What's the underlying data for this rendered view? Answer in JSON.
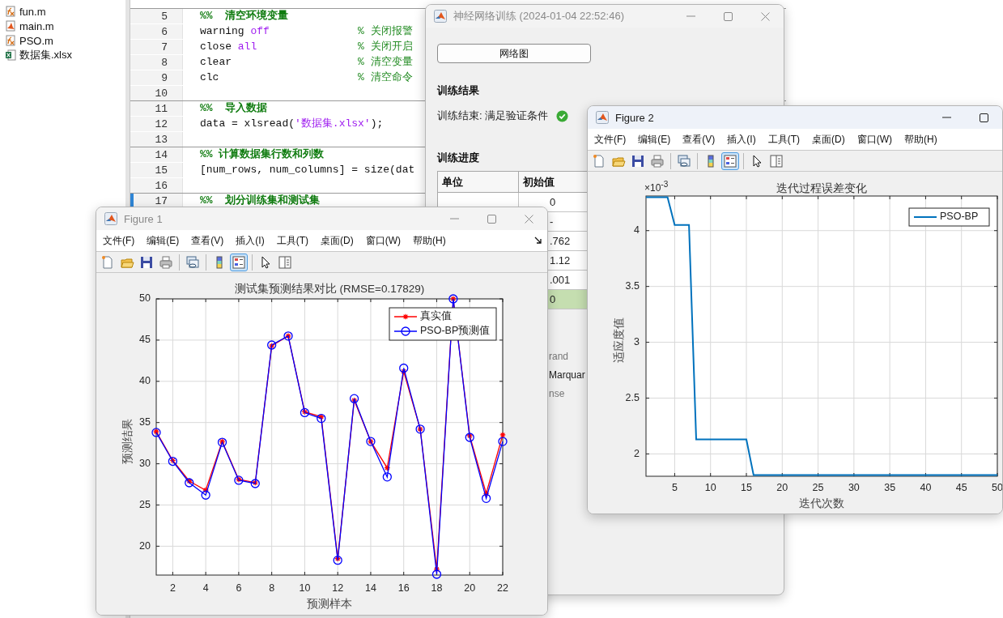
{
  "file_browser": {
    "files": [
      {
        "name": "fun.m",
        "kind": "function"
      },
      {
        "name": "main.m",
        "kind": "script"
      },
      {
        "name": "PSO.m",
        "kind": "function"
      },
      {
        "name": "数据集.xlsx",
        "kind": "spreadsheet"
      }
    ]
  },
  "editor": {
    "lines": [
      {
        "number": "5",
        "current": false,
        "segments": [
          {
            "kind": "section",
            "text": "%%  清空环境变量"
          }
        ]
      },
      {
        "number": "6",
        "current": false,
        "segments": [
          {
            "kind": "plain",
            "text": "warning "
          },
          {
            "kind": "keyword",
            "text": "off"
          },
          {
            "kind": "comment",
            "text": "% 关闭报警"
          }
        ]
      },
      {
        "number": "7",
        "current": false,
        "segments": [
          {
            "kind": "plain",
            "text": "close "
          },
          {
            "kind": "keyword",
            "text": "all"
          },
          {
            "kind": "comment",
            "text": "% 关闭开启"
          }
        ]
      },
      {
        "number": "8",
        "current": false,
        "segments": [
          {
            "kind": "plain",
            "text": "clear"
          },
          {
            "kind": "comment",
            "text": "% 清空变量"
          }
        ]
      },
      {
        "number": "9",
        "current": false,
        "segments": [
          {
            "kind": "plain",
            "text": "clc"
          },
          {
            "kind": "comment",
            "text": "% 清空命令"
          }
        ]
      },
      {
        "number": "10",
        "current": false
      },
      {
        "number": "11",
        "current": false,
        "segments": [
          {
            "kind": "section",
            "text": "%%  导入数据"
          }
        ]
      },
      {
        "number": "12",
        "current": false,
        "segments": [
          {
            "kind": "plain",
            "text": "data = xlsread("
          },
          {
            "kind": "string",
            "text": "'数据集.xlsx'"
          },
          {
            "kind": "plain",
            "text": ");"
          }
        ]
      },
      {
        "number": "13",
        "current": false
      },
      {
        "number": "14",
        "current": false,
        "segments": [
          {
            "kind": "section",
            "text": "%% 计算数据集行数和列数"
          }
        ]
      },
      {
        "number": "15",
        "current": false,
        "segments": [
          {
            "kind": "plain",
            "text": "[num_rows, num_columns] = size(dat"
          }
        ]
      },
      {
        "number": "16",
        "current": false
      },
      {
        "number": "17",
        "current": true,
        "segments": [
          {
            "kind": "section",
            "text": "%%  划分训练集和测试集"
          }
        ]
      }
    ]
  },
  "training_window": {
    "title": "神经网络训练 (2024-01-04 22:52:46)",
    "active": false,
    "button": "网络图",
    "result_heading": "训练结果",
    "result_text": "训练结束: 满足验证条件",
    "result_ok": true,
    "progress_heading": "训练进度",
    "table": {
      "columns": [
        "单位",
        "初始值"
      ],
      "rows": [
        {
          "value": "0",
          "highlighted": false
        },
        {
          "value": "-",
          "highlighted": false
        },
        {
          "value": ".762",
          "highlighted": false
        },
        {
          "value": "1.12",
          "highlighted": false
        },
        {
          "value": ".001",
          "highlighted": false
        },
        {
          "value": "0",
          "highlighted": true
        }
      ]
    },
    "algorithm_fragments": [
      {
        "text": "rand",
        "disabled": true
      },
      {
        "text": "Marquar",
        "disabled": false
      },
      {
        "text": "nse",
        "disabled": true
      }
    ]
  },
  "figures": [
    {
      "title": "Figure 1",
      "active": false,
      "dockable": true,
      "menu": [
        "文件(F)",
        "编辑(E)",
        "查看(V)",
        "插入(I)",
        "工具(T)",
        "桌面(D)",
        "窗口(W)",
        "帮助(H)"
      ],
      "toolbar": [
        {
          "kind": "new",
          "selected": false
        },
        {
          "kind": "open",
          "selected": false
        },
        {
          "kind": "save",
          "selected": false
        },
        {
          "kind": "print",
          "selected": false
        },
        {
          "kind": "separator"
        },
        {
          "kind": "link",
          "selected": false
        },
        {
          "kind": "separator"
        },
        {
          "kind": "colorbar",
          "selected": false
        },
        {
          "kind": "legend",
          "selected": true
        },
        {
          "kind": "separator"
        },
        {
          "kind": "pointer",
          "selected": false
        },
        {
          "kind": "inspector",
          "selected": false
        }
      ],
      "chart_data": {
        "type": "line",
        "title": "测试集预测结果对比 (RMSE=0.17829)",
        "xlabel": "预测样本",
        "ylabel": "预测结果",
        "grid": true,
        "legend": true,
        "x": [
          1,
          2,
          3,
          4,
          5,
          6,
          7,
          8,
          9,
          10,
          11,
          12,
          13,
          14,
          15,
          16,
          17,
          18,
          19,
          20,
          21,
          22
        ],
        "series": [
          {
            "name": "真实值",
            "color": "#ff0000",
            "marker": "cross",
            "values": [
              33.9,
              30.4,
              27.9,
              26.8,
              32.7,
              28.1,
              27.7,
              44.3,
              45.5,
              36.3,
              35.7,
              18.5,
              37.7,
              32.7,
              29.5,
              41.2,
              34.2,
              17.2,
              50.0,
              33.4,
              26.4,
              33.5
            ]
          },
          {
            "name": "PSO-BP预测值",
            "color": "#0000ff",
            "marker": "circle",
            "values": [
              33.8,
              30.3,
              27.7,
              26.2,
              32.6,
              28.0,
              27.6,
              44.4,
              45.5,
              36.2,
              35.5,
              18.3,
              37.9,
              32.7,
              28.4,
              41.6,
              34.2,
              16.6,
              50.0,
              33.2,
              25.8,
              32.7
            ]
          }
        ],
        "xlim": [
          1,
          22
        ],
        "ylim": [
          16.5,
          50
        ],
        "xticks": [
          {
            "value": 2,
            "label": "2"
          },
          {
            "value": 4,
            "label": "4"
          },
          {
            "value": 6,
            "label": "6"
          },
          {
            "value": 8,
            "label": "8"
          },
          {
            "value": 10,
            "label": "10"
          },
          {
            "value": 12,
            "label": "12"
          },
          {
            "value": 14,
            "label": "14"
          },
          {
            "value": 16,
            "label": "16"
          },
          {
            "value": 18,
            "label": "18"
          },
          {
            "value": 20,
            "label": "20"
          },
          {
            "value": 22,
            "label": "22"
          }
        ],
        "yticks": [
          {
            "value": 20,
            "label": "20"
          },
          {
            "value": 25,
            "label": "25"
          },
          {
            "value": 30,
            "label": "30"
          },
          {
            "value": 35,
            "label": "35"
          },
          {
            "value": 40,
            "label": "40"
          },
          {
            "value": 45,
            "label": "45"
          },
          {
            "value": 50,
            "label": "50"
          }
        ]
      }
    },
    {
      "title": "Figure 2",
      "active": true,
      "dockable": false,
      "menu": [
        "文件(F)",
        "编辑(E)",
        "查看(V)",
        "插入(I)",
        "工具(T)",
        "桌面(D)",
        "窗口(W)",
        "帮助(H)"
      ],
      "toolbar": [
        {
          "kind": "new",
          "selected": false
        },
        {
          "kind": "open",
          "selected": false
        },
        {
          "kind": "save",
          "selected": false
        },
        {
          "kind": "print",
          "selected": false
        },
        {
          "kind": "separator"
        },
        {
          "kind": "link",
          "selected": false
        },
        {
          "kind": "separator"
        },
        {
          "kind": "colorbar",
          "selected": false
        },
        {
          "kind": "legend",
          "selected": true
        },
        {
          "kind": "separator"
        },
        {
          "kind": "pointer",
          "selected": false
        },
        {
          "kind": "inspector",
          "selected": false
        }
      ],
      "chart_data": {
        "type": "line",
        "title": "迭代过程误差变化",
        "xlabel": "迭代次数",
        "ylabel": "适应度值",
        "grid": true,
        "legend": true,
        "annotations": [
          {
            "text": "×10$^{-3}$"
          }
        ],
        "x": [
          1,
          2,
          3,
          4,
          5,
          6,
          7,
          8,
          9,
          10,
          11,
          12,
          13,
          14,
          15,
          16,
          17,
          18,
          19,
          20,
          21,
          22,
          23,
          24,
          25,
          26,
          27,
          28,
          29,
          30,
          31,
          32,
          33,
          34,
          35,
          36,
          37,
          38,
          39,
          40,
          41,
          42,
          43,
          44,
          45,
          46,
          47,
          48,
          49,
          50
        ],
        "series": [
          {
            "name": "PSO-BP",
            "color": "#0072bd",
            "values": [
              4.3,
              4.3,
              4.3,
              4.3,
              4.05,
              4.05,
              4.05,
              2.13,
              2.13,
              2.13,
              2.13,
              2.13,
              2.13,
              2.13,
              2.13,
              1.81,
              1.81,
              1.81,
              1.81,
              1.81,
              1.81,
              1.81,
              1.81,
              1.81,
              1.81,
              1.81,
              1.81,
              1.81,
              1.81,
              1.81,
              1.81,
              1.81,
              1.81,
              1.81,
              1.81,
              1.81,
              1.81,
              1.81,
              1.81,
              1.81,
              1.81,
              1.81,
              1.81,
              1.81,
              1.81,
              1.81,
              1.81,
              1.81,
              1.81,
              1.81
            ]
          }
        ],
        "xlim": [
          1,
          50
        ],
        "ylim": [
          1.8,
          4.31
        ],
        "xticks": [
          {
            "value": 5,
            "label": "5"
          },
          {
            "value": 10,
            "label": "10"
          },
          {
            "value": 15,
            "label": "15"
          },
          {
            "value": 20,
            "label": "20"
          },
          {
            "value": 25,
            "label": "25"
          },
          {
            "value": 30,
            "label": "30"
          },
          {
            "value": 35,
            "label": "35"
          },
          {
            "value": 40,
            "label": "40"
          },
          {
            "value": 45,
            "label": "45"
          },
          {
            "value": 50,
            "label": "50"
          }
        ],
        "yticks": [
          {
            "value": 2,
            "label": "2"
          },
          {
            "value": 2.5,
            "label": "2.5"
          },
          {
            "value": 3,
            "label": "3"
          },
          {
            "value": 3.5,
            "label": "3.5"
          },
          {
            "value": 4,
            "label": "4"
          }
        ]
      }
    }
  ]
}
